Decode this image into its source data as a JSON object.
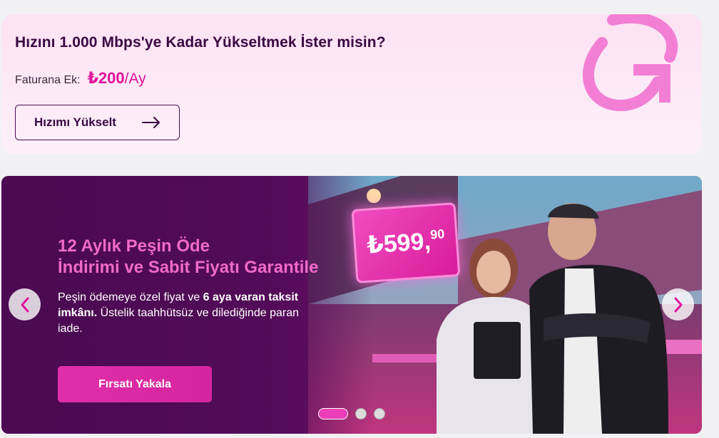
{
  "upgrade": {
    "title": "Hızını 1.000 Mbps'ye Kadar Yükseltmek İster misin?",
    "fee_label": "Faturana Ek:",
    "fee_price": "₺200",
    "fee_unit": "/Ay",
    "button_label": "Hızımı Yükselt"
  },
  "promo": {
    "headline_line1": "12 Aylık Peşin Öde",
    "headline_line2": "İndirimi ve Sabit Fiyatı Garantile",
    "desc_part1": "Peşin ödemeye özel fiyat ve ",
    "desc_bold": "6 aya varan taksit imkânı.",
    "desc_part2": " Üstelik taahhütsüz ve dilediğinde paran iade.",
    "cta_label": "Fırsatı Yakala",
    "price_main": "₺599,",
    "price_decimals": "90",
    "slide_count": 3,
    "active_slide": 1
  },
  "colors": {
    "accent": "#e1129b",
    "title": "#3a0742",
    "promo_bg": "#4b0a52",
    "headline": "#f06ac8"
  },
  "icons": [
    "arrow-right-icon",
    "chevron-left-icon",
    "chevron-right-icon",
    "refresh-arrow-icon"
  ]
}
